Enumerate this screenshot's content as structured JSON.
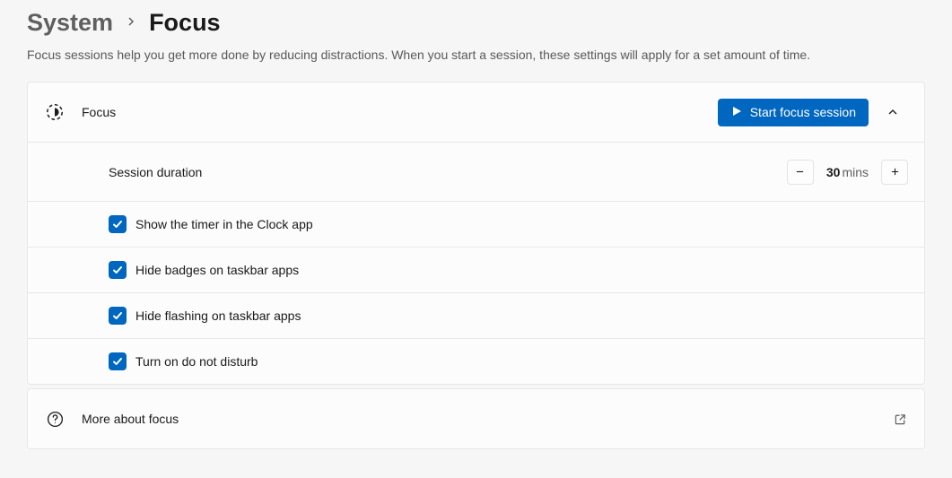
{
  "breadcrumb": {
    "parent": "System",
    "current": "Focus"
  },
  "description": "Focus sessions help you get more done by reducing distractions. When you start a session, these settings will apply for a set amount of time.",
  "focus_card": {
    "header_label": "Focus",
    "start_button": "Start focus session",
    "duration": {
      "label": "Session duration",
      "value": "30",
      "unit": "mins"
    },
    "options": [
      {
        "label": "Show the timer in the Clock app",
        "checked": true
      },
      {
        "label": "Hide badges on taskbar apps",
        "checked": true
      },
      {
        "label": "Hide flashing on taskbar apps",
        "checked": true
      },
      {
        "label": "Turn on do not disturb",
        "checked": true
      }
    ]
  },
  "more_about": {
    "label": "More about focus"
  }
}
